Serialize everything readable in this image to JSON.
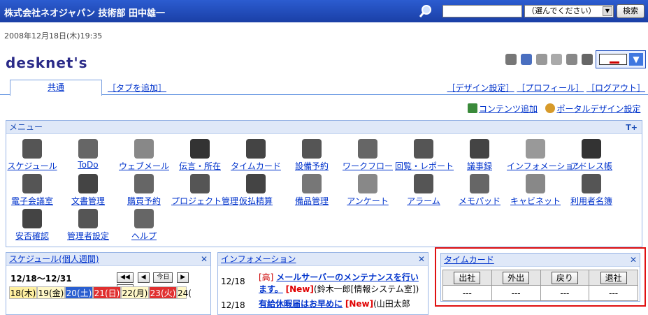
{
  "header": {
    "user": "株式会社ネオジャパン 技術部 田中雄一",
    "search_select": "（選んでください）",
    "search_button": "検索"
  },
  "datetime": "2008年12月18日(木)19:35",
  "logo": "desknet's",
  "tabs": {
    "active": "共通",
    "add": "［タブを追加］"
  },
  "toplinks": {
    "design": "［デザイン設定］",
    "profile": "［プロフィール］",
    "logout": "［ログアウト］"
  },
  "content_links": {
    "add_content": "コンテンツ追加",
    "portal_design": "ポータルデザイン設定"
  },
  "menu": {
    "title": "メニュー",
    "items": [
      "スケジュール",
      "ToDo",
      "ウェブメール",
      "伝言・所在",
      "タイムカード",
      "設備予約",
      "ワークフロー",
      "回覧・レポート",
      "議事録",
      "インフォメーション",
      "アドレス帳",
      "電子会議室",
      "文書管理",
      "購買予約",
      "プロジェクト管理",
      "仮払精算",
      "備品管理",
      "アンケート",
      "アラーム",
      "メモパッド",
      "キャビネット",
      "利用者名簿",
      "安否確認",
      "管理者設定",
      "ヘルプ"
    ]
  },
  "schedule": {
    "title": "スケジュール(個人週間)",
    "range": "12/18～12/31",
    "nav_today": "今日",
    "days": [
      "18(木)",
      "19(金)",
      "20(土)",
      "21(日)",
      "22(月)",
      "23(火)",
      "24("
    ]
  },
  "info": {
    "title": "インフォメーション",
    "rows": [
      {
        "date": "12/18",
        "tag": "[高]",
        "title": "メールサーバーのメンテナンスを行います。",
        "new": "[New]",
        "author": "(鈴木一郎[情報システム室])"
      },
      {
        "date": "12/18",
        "tag": "",
        "title": "有給休暇届はお早めに",
        "new": "[New]",
        "author": "(山田太郎"
      }
    ]
  },
  "timecard": {
    "title": "タイムカード",
    "buttons": [
      "出社",
      "外出",
      "戻り",
      "退社"
    ],
    "values": [
      "---",
      "---",
      "---",
      "---"
    ]
  }
}
